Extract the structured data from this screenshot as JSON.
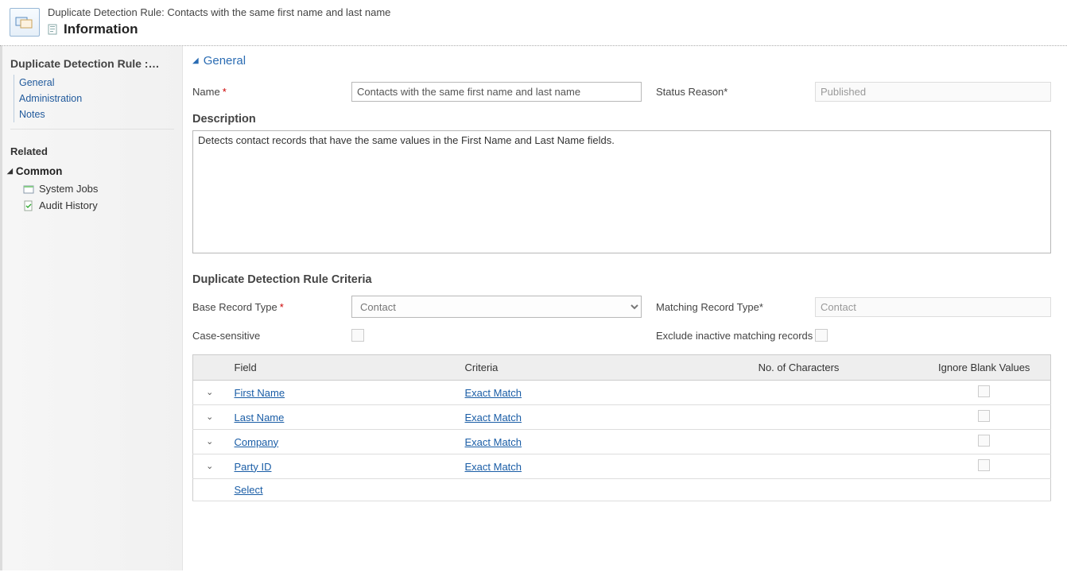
{
  "header": {
    "rule_prefix": "Duplicate Detection Rule:",
    "rule_name": "Contacts with the same first name and last name",
    "info_label": "Information"
  },
  "sidebar": {
    "section_title": "Duplicate Detection Rule :…",
    "nav_links": [
      "General",
      "Administration",
      "Notes"
    ],
    "related_label": "Related",
    "common_label": "Common",
    "items": [
      {
        "label": "System Jobs"
      },
      {
        "label": "Audit History"
      }
    ]
  },
  "general": {
    "section_label": "General",
    "name_label": "Name",
    "name_value": "Contacts with the same first name and last name",
    "status_label": "Status Reason",
    "status_value": "Published",
    "description_label": "Description",
    "description_value": "Detects contact records that have the same values in the First Name and Last Name fields."
  },
  "criteria": {
    "heading": "Duplicate Detection Rule Criteria",
    "base_type_label": "Base Record Type",
    "base_type_value": "Contact",
    "matching_type_label": "Matching Record Type",
    "matching_type_value": "Contact",
    "case_sensitive_label": "Case-sensitive",
    "exclude_inactive_label": "Exclude inactive matching records",
    "columns": {
      "field": "Field",
      "criteria": "Criteria",
      "numchars": "No. of Characters",
      "ignore": "Ignore Blank Values"
    },
    "rows": [
      {
        "field": "First Name",
        "criteria": "Exact Match"
      },
      {
        "field": "Last Name",
        "criteria": "Exact Match"
      },
      {
        "field": "Company",
        "criteria": "Exact Match"
      },
      {
        "field": "Party ID",
        "criteria": "Exact Match"
      }
    ],
    "select_label": "Select"
  }
}
